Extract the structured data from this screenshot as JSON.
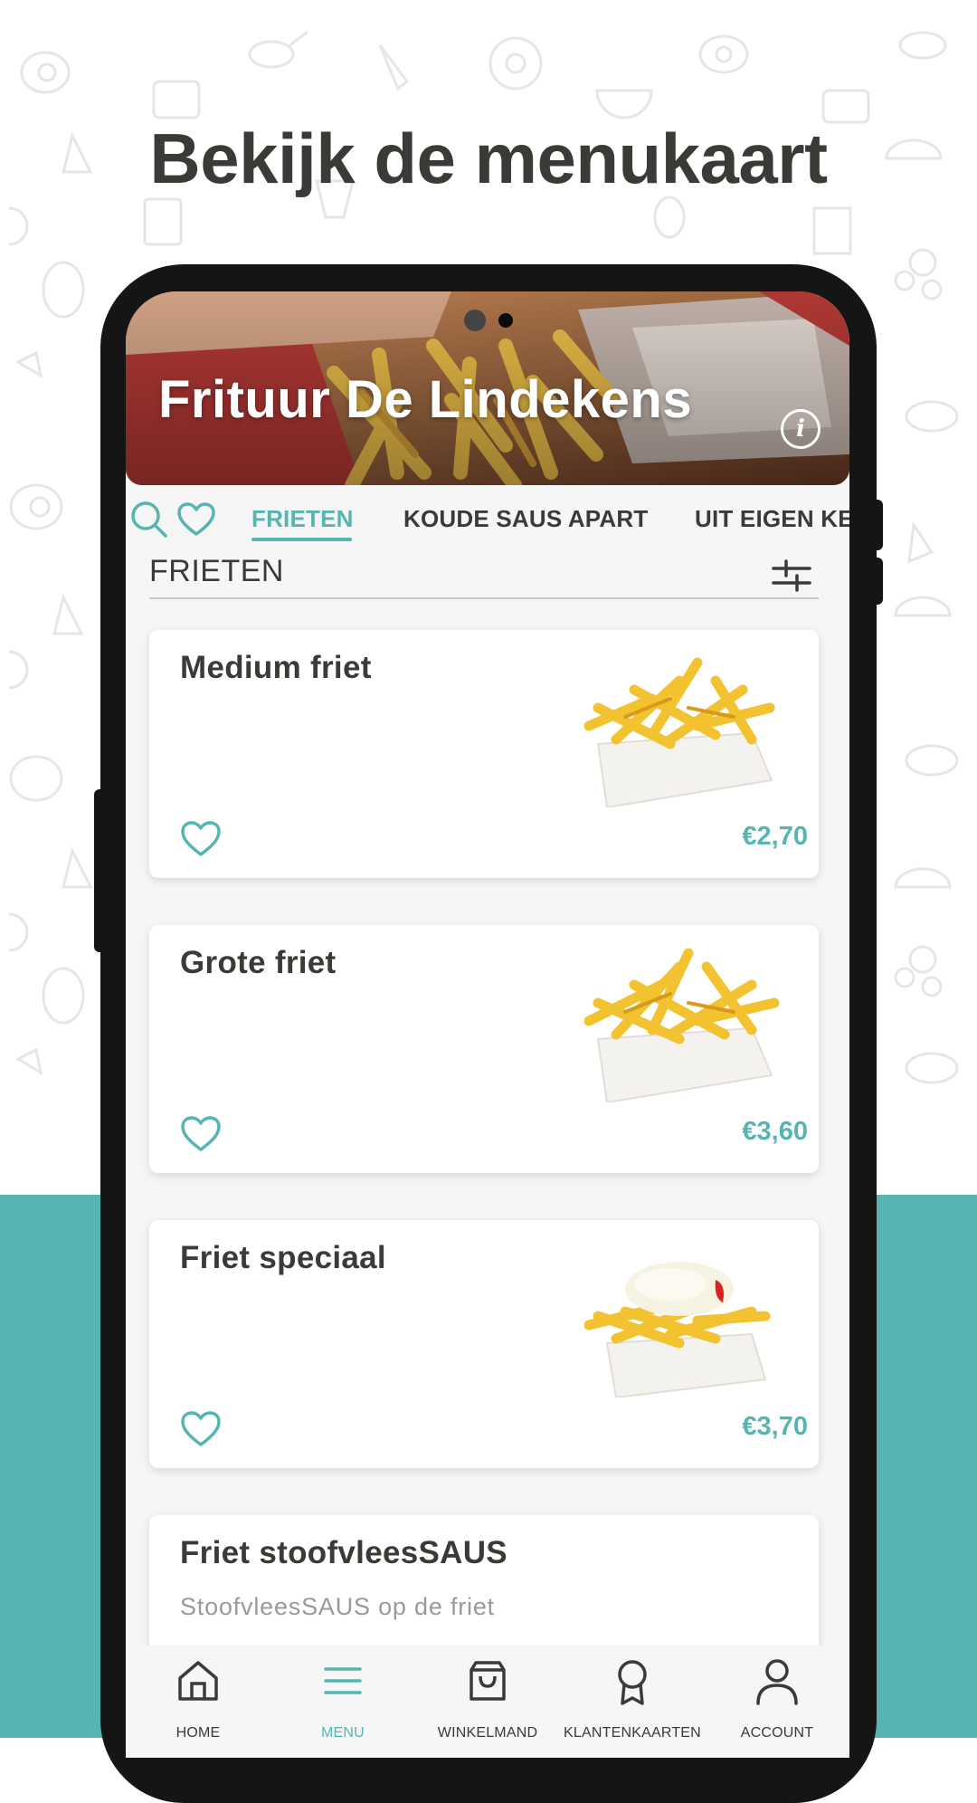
{
  "headline": "Bekijk de menukaart",
  "colors": {
    "accent": "#57b5b1",
    "text": "#3b3a36",
    "phone": "#151515"
  },
  "restaurant": {
    "name": "Frituur De Lindekens",
    "info_icon": "info-icon",
    "info_label": "i"
  },
  "tabs": {
    "icons": [
      "search-icon",
      "heart-icon"
    ],
    "items": [
      {
        "label": "FRIETEN",
        "active": true
      },
      {
        "label": "KOUDE SAUS APART",
        "active": false
      },
      {
        "label": "UIT EIGEN KE",
        "active": false
      }
    ]
  },
  "section": {
    "title": "FRIETEN",
    "filter_icon": "sliders-icon"
  },
  "products": [
    {
      "name": "Medium friet",
      "description": "",
      "price": "€2,70",
      "image": "fries-medium"
    },
    {
      "name": "Grote friet",
      "description": "",
      "price": "€3,60",
      "image": "fries-large"
    },
    {
      "name": "Friet speciaal",
      "description": "",
      "price": "€3,70",
      "image": "fries-special"
    },
    {
      "name": "Friet stoofvleesSAUS",
      "description": "StoofvleesSAUS op de friet",
      "price": "",
      "image": ""
    }
  ],
  "bottom_nav": [
    {
      "label": "HOME",
      "icon": "home-icon",
      "active": false
    },
    {
      "label": "MENU",
      "icon": "menu-icon",
      "active": true
    },
    {
      "label": "WINKELMAND",
      "icon": "shopping-bag-icon",
      "active": false
    },
    {
      "label": "KLANTENKAARTEN",
      "icon": "award-icon",
      "active": false
    },
    {
      "label": "ACCOUNT",
      "icon": "user-icon",
      "active": false
    }
  ]
}
